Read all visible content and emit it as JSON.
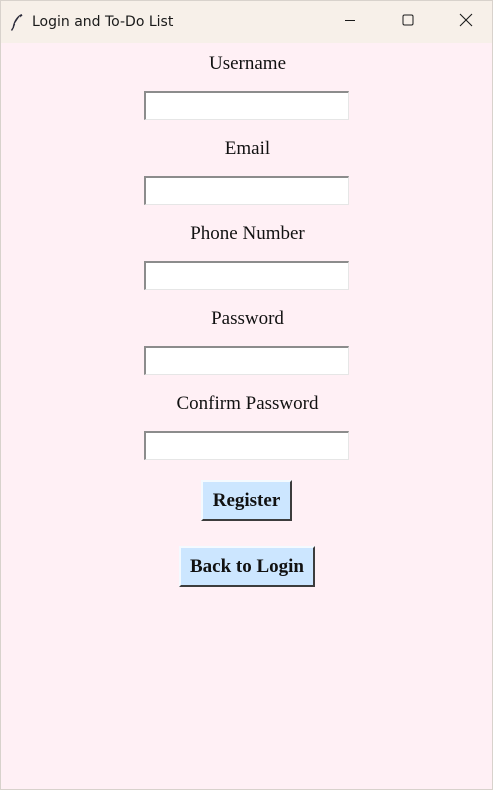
{
  "window": {
    "title": "Login and To-Do List",
    "icon": "feather-icon",
    "controls": {
      "minimize_icon": "minimize-icon",
      "maximize_icon": "maximize-icon",
      "close_icon": "close-icon"
    }
  },
  "form": {
    "username": {
      "label": "Username",
      "value": ""
    },
    "email": {
      "label": "Email",
      "value": ""
    },
    "phone": {
      "label": "Phone Number",
      "value": ""
    },
    "password": {
      "label": "Password",
      "value": ""
    },
    "confirm_password": {
      "label": "Confirm Password",
      "value": ""
    }
  },
  "actions": {
    "register_label": "Register",
    "back_label": "Back to Login"
  },
  "colors": {
    "background": "#fff0f5",
    "titlebar": "#f7f0e9",
    "button": "#cce6ff"
  }
}
